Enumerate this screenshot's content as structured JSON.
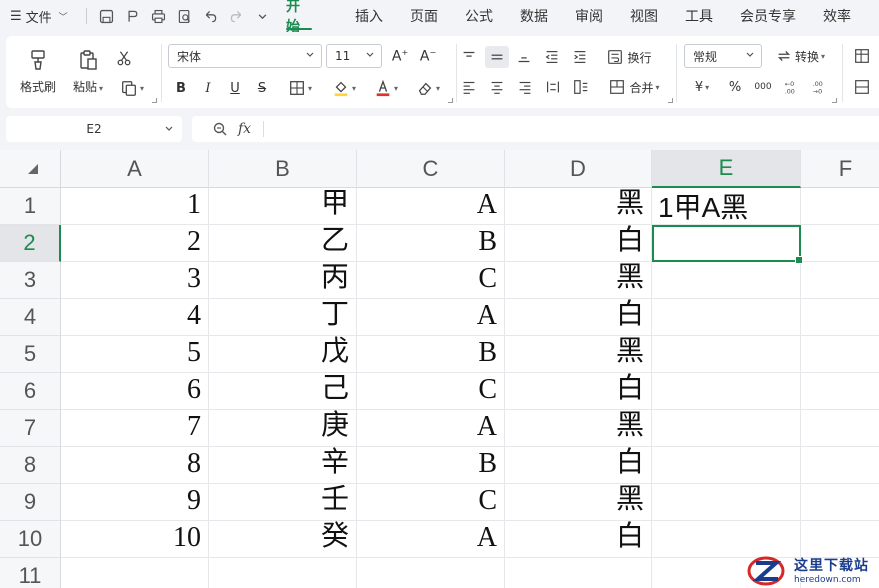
{
  "menu": {
    "file_label": "文件",
    "tabs": [
      "开始",
      "插入",
      "页面",
      "公式",
      "数据",
      "审阅",
      "视图",
      "工具",
      "会员专享",
      "效率"
    ],
    "active_tab": "开始"
  },
  "ribbon": {
    "format_painter": "格式刷",
    "paste": "粘贴",
    "font_name": "宋体",
    "font_size": "11",
    "bold": "B",
    "italic": "I",
    "underline": "U",
    "strikethrough": "S",
    "wrap_text": "换行",
    "merge": "合并",
    "number_format": "常规",
    "convert": "转换",
    "currency": "¥",
    "percent": "%",
    "thousands": "000",
    "font_color": "#e03131",
    "fill_color": "#ffd43b",
    "accent": "#1c8b4f"
  },
  "formula_bar": {
    "name_box": "E2",
    "fx": "fx",
    "content": ""
  },
  "sheet": {
    "columns": [
      "A",
      "B",
      "C",
      "D",
      "E",
      "F"
    ],
    "selected_column": "E",
    "selected_row": "2",
    "rows": [
      {
        "num": "1",
        "A": "1",
        "B": "甲",
        "C": "A",
        "D": "黑",
        "E": "1甲A黑"
      },
      {
        "num": "2",
        "A": "2",
        "B": "乙",
        "C": "B",
        "D": "白",
        "E": ""
      },
      {
        "num": "3",
        "A": "3",
        "B": "丙",
        "C": "C",
        "D": "黑",
        "E": ""
      },
      {
        "num": "4",
        "A": "4",
        "B": "丁",
        "C": "A",
        "D": "白",
        "E": ""
      },
      {
        "num": "5",
        "A": "5",
        "B": "戊",
        "C": "B",
        "D": "黑",
        "E": ""
      },
      {
        "num": "6",
        "A": "6",
        "B": "己",
        "C": "C",
        "D": "白",
        "E": ""
      },
      {
        "num": "7",
        "A": "7",
        "B": "庚",
        "C": "A",
        "D": "黑",
        "E": ""
      },
      {
        "num": "8",
        "A": "8",
        "B": "辛",
        "C": "B",
        "D": "白",
        "E": ""
      },
      {
        "num": "9",
        "A": "9",
        "B": "壬",
        "C": "C",
        "D": "黑",
        "E": ""
      },
      {
        "num": "10",
        "A": "10",
        "B": "癸",
        "C": "A",
        "D": "白",
        "E": ""
      },
      {
        "num": "11",
        "A": "",
        "B": "",
        "C": "",
        "D": "",
        "E": ""
      }
    ]
  },
  "watermark": {
    "title": "这里下载站",
    "url": "heredown.com"
  }
}
